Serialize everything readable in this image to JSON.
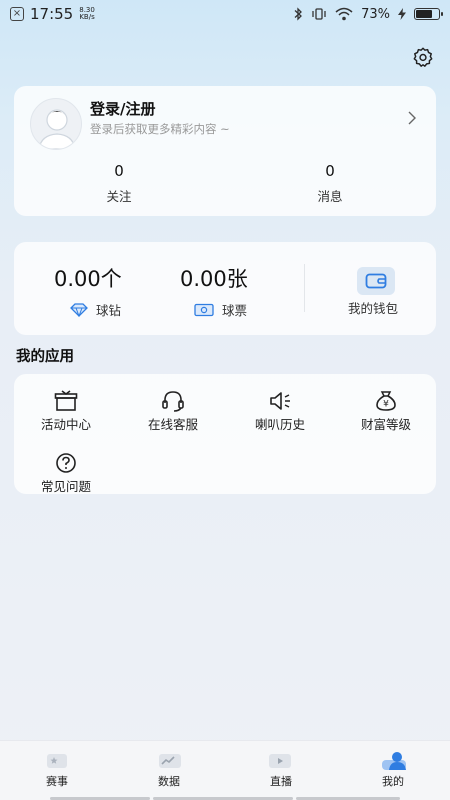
{
  "status_bar": {
    "time": "17:55",
    "speed_value": "8.30",
    "speed_unit": "KB/s",
    "battery": "73%",
    "battery_level": 0.73
  },
  "profile": {
    "login_title": "登录/注册",
    "login_subtitle": "登录后获取更多精彩内容 ~",
    "stats": [
      {
        "value": "0",
        "label": "关注"
      },
      {
        "value": "0",
        "label": "消息"
      }
    ]
  },
  "wallet": {
    "diamonds_amount": "0.00个",
    "diamonds_label": "球钻",
    "tickets_amount": "0.00张",
    "tickets_label": "球票",
    "my_wallet_label": "我的钱包"
  },
  "apps": {
    "title": "我的应用",
    "items": [
      {
        "label": "活动中心",
        "icon": "gift-box-icon"
      },
      {
        "label": "在线客服",
        "icon": "headset-icon"
      },
      {
        "label": "喇叭历史",
        "icon": "speaker-icon"
      },
      {
        "label": "财富等级",
        "icon": "money-bag-icon"
      },
      {
        "label": "常见问题",
        "icon": "question-icon"
      }
    ]
  },
  "bottom_nav": {
    "items": [
      {
        "label": "赛事",
        "icon": "trophy-icon"
      },
      {
        "label": "数据",
        "icon": "chart-icon"
      },
      {
        "label": "直播",
        "icon": "play-icon"
      },
      {
        "label": "我的",
        "icon": "user-icon",
        "active": true
      }
    ]
  },
  "colors": {
    "accent": "#2f7de1"
  }
}
